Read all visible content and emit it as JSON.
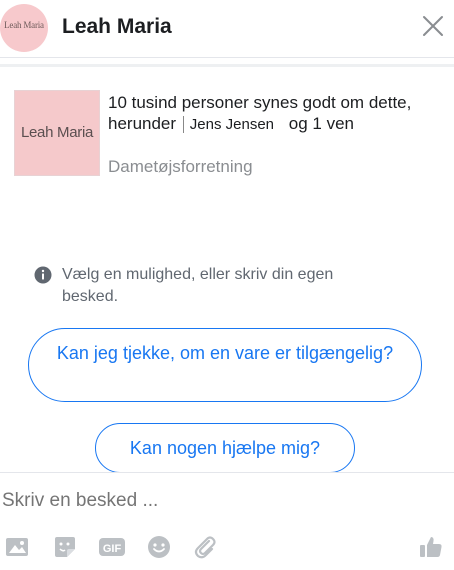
{
  "header": {
    "avatar_text": "Leah Maria",
    "title": "Leah Maria",
    "close_icon": "close-icon"
  },
  "card": {
    "image_text": "Leah Maria",
    "line1": "10 tusind personer synes godt om dette, herunder",
    "tag_name": "Jens Jensen",
    "line_end": "og 1 ven",
    "subtitle": "Dametøjsforretning"
  },
  "info": {
    "icon": "info-icon",
    "text": "Vælg en mulighed, eller skriv din egen besked."
  },
  "quick_replies": [
    {
      "label": "Kan jeg tjekke, om en vare er tilgængelig?"
    },
    {
      "label": "Kan nogen hjælpe mig?"
    }
  ],
  "composer": {
    "placeholder": "Skriv en besked ..."
  },
  "toolbar": {
    "icons": [
      "image-icon",
      "sticker-icon",
      "gif-icon",
      "emoji-icon",
      "attachment-icon",
      "like-icon"
    ],
    "gif_label": "GIF"
  },
  "colors": {
    "accent": "#1877f2",
    "icon_gray": "#bcc0c4",
    "brand_pink": "#f5c9cb"
  }
}
